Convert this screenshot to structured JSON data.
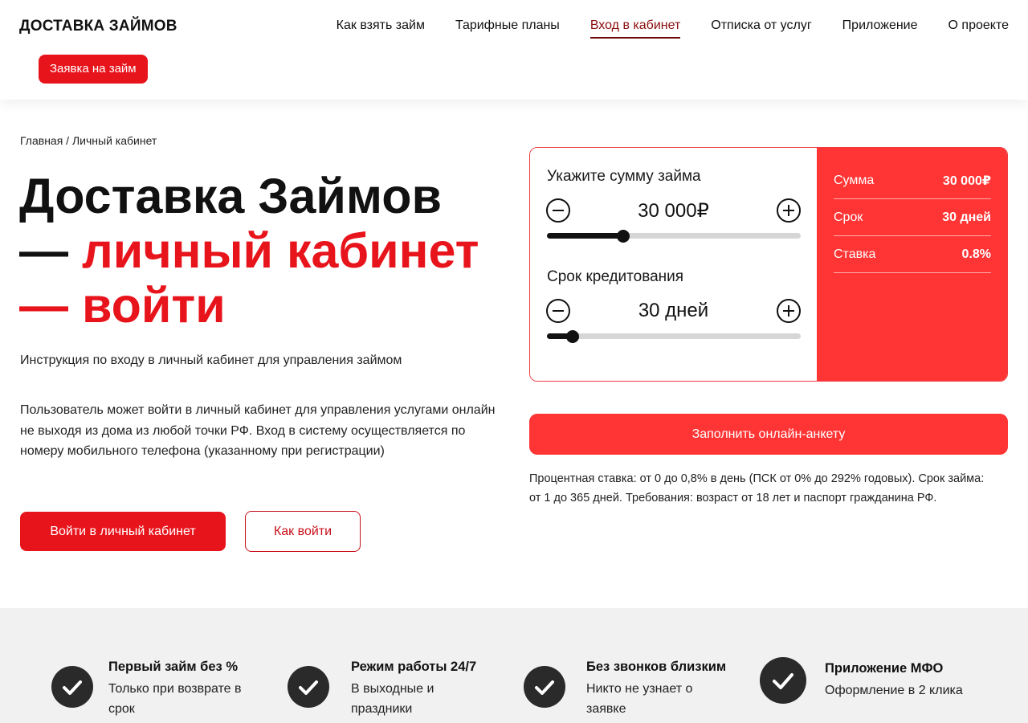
{
  "header": {
    "logo": "ДОСТАВКА ЗАЙМОВ",
    "nav": [
      {
        "label": "Как взять займ"
      },
      {
        "label": "Тарифные планы"
      },
      {
        "label": "Вход в кабинет",
        "active": true
      },
      {
        "label": "Отписка от услуг"
      },
      {
        "label": "Приложение"
      },
      {
        "label": "О проекте"
      }
    ],
    "apply_button": "Заявка на займ"
  },
  "breadcrumb": {
    "home": "Главная",
    "separator": " / ",
    "current": "Личный кабинет"
  },
  "hero": {
    "line1": "Доставка Займов",
    "dash": "— ",
    "line2": "личный кабинет",
    "line3": "войти",
    "subtitle": "Инструкция по входу в личный кабинет для управления займом",
    "body": "Пользователь может войти в личный кабинет для управления услугами онлайн не выходя из дома из любой точки РФ. Вход в систему осуществляется по номеру мобильного телефона (указанному при регистрации)",
    "primary_button": "Войти в личный кабинет",
    "secondary_button": "Как войти"
  },
  "calculator": {
    "amount_label": "Укажите сумму займа",
    "amount_value": "30 000₽",
    "amount_fraction": 0.3,
    "term_label": "Срок кредитования",
    "term_value": "30 дней",
    "term_fraction": 0.1,
    "summary": [
      {
        "label": "Сумма",
        "value": "30 000₽"
      },
      {
        "label": "Срок",
        "value": "30 дней"
      },
      {
        "label": "Ставка",
        "value": "0.8%"
      }
    ],
    "form_button": "Заполнить онлайн-анкету",
    "terms": "Процентная ставка: от 0 до 0,8% в день (ПСК от 0% до 292% годовых). Срок займа: от 1 до 365 дней. Требования: возраст от 18 лет и паспорт гражданина РФ."
  },
  "features": [
    {
      "title": "Первый займ без %",
      "desc": "Только при возврате в срок"
    },
    {
      "title": "Режим работы 24/7",
      "desc": "В выходные и праздники"
    },
    {
      "title": "Без звонков близким",
      "desc": "Никто не узнает о заявке"
    },
    {
      "title": "Приложение МФО",
      "desc": "Оформление в 2 клика"
    }
  ],
  "colors": {
    "accent": "#e8141c",
    "calc_panel": "#ff3434",
    "nav_active": "#8b0f0f",
    "features_bg": "#f1f1f1"
  },
  "icons": {
    "minus": "minus-circle-icon",
    "plus": "plus-circle-icon",
    "check": "check-circle-icon"
  }
}
